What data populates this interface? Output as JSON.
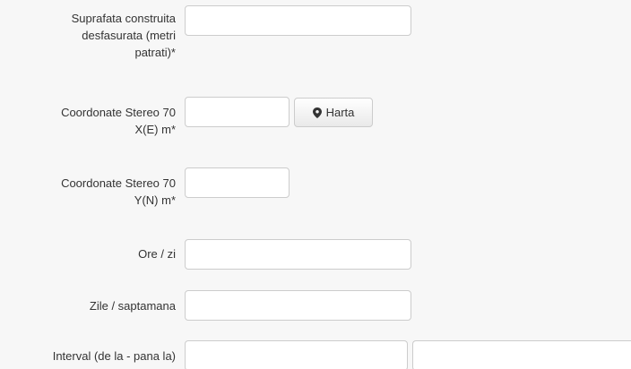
{
  "fields": {
    "suprafata": {
      "label_lines": [
        "Suprafata construita",
        "desfasurata (metri",
        "patrati)*"
      ],
      "value": "",
      "placeholder": ""
    },
    "coord_x": {
      "label_lines": [
        "Coordonate Stereo 70",
        "X(E) m*"
      ],
      "value": "",
      "placeholder": "",
      "map_button_label": "Harta",
      "map_button_icon": "map-marker-icon"
    },
    "coord_y": {
      "label_lines": [
        "Coordonate Stereo 70",
        "Y(N) m*"
      ],
      "value": "",
      "placeholder": ""
    },
    "ore_zi": {
      "label": "Ore / zi",
      "value": "",
      "placeholder": ""
    },
    "zile_saptamana": {
      "label": "Zile / saptamana",
      "value": "",
      "placeholder": ""
    },
    "interval": {
      "label": "Interval (de la - pana la)",
      "from_value": "",
      "to_value": "",
      "placeholder": ""
    }
  },
  "colors": {
    "background": "#f7f7f7",
    "input_border": "#cccccc",
    "text": "#333333"
  }
}
